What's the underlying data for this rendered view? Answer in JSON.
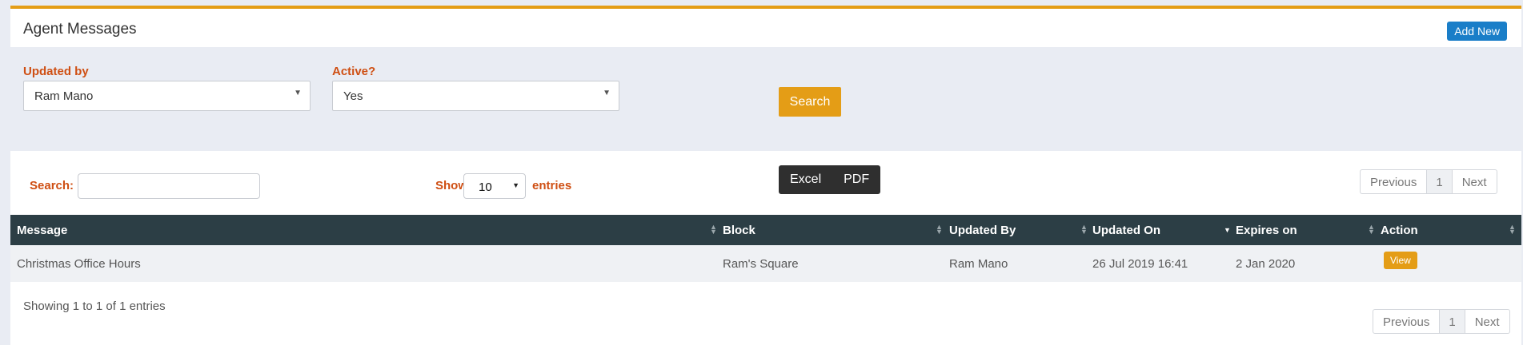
{
  "header": {
    "title": "Agent Messages",
    "add_new_label": "Add New"
  },
  "filters": {
    "updated_by": {
      "label": "Updated by",
      "value": "Ram Mano"
    },
    "active": {
      "label": "Active?",
      "value": "Yes"
    },
    "search_label": "Search"
  },
  "toolbar": {
    "search_label": "Search:",
    "search_value": "",
    "show_label": "Show",
    "length_value": "10",
    "entries_label": "entries",
    "excel_label": "Excel",
    "pdf_label": "PDF"
  },
  "pager": {
    "previous": "Previous",
    "page": "1",
    "next": "Next"
  },
  "table": {
    "columns": [
      "Message",
      "Block",
      "Updated By",
      "Updated On",
      "Expires on",
      "Action"
    ],
    "rows": [
      {
        "message": "Christmas Office Hours",
        "block": "Ram's Square",
        "updated_by": "Ram Mano",
        "updated_on": "26 Jul 2019 16:41",
        "expires_on": "2 Jan 2020",
        "action": "View"
      }
    ]
  },
  "info": "Showing 1 to 1 of 1 entries",
  "colors": {
    "accent": "#e49d16",
    "primary": "#1a7ec8",
    "label": "#cf4f13",
    "table_header": "#2c3e45"
  }
}
